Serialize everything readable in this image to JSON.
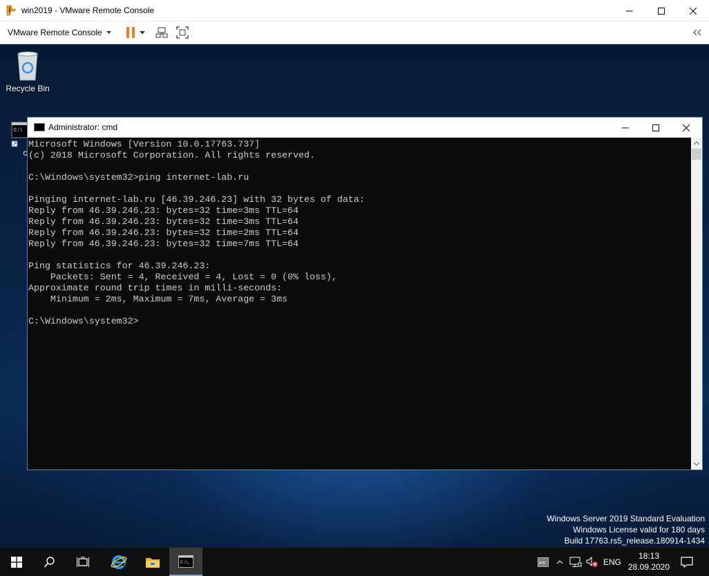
{
  "vmware": {
    "title": "win2019 - VMware Remote Console",
    "menu_label": "VMware Remote Console"
  },
  "desktop": {
    "icons": [
      {
        "label": "Recycle Bin"
      },
      {
        "label": "cmd"
      }
    ],
    "watermark": {
      "line1": "Windows Server 2019 Standard Evaluation",
      "line2": "Windows License valid for 180 days",
      "line3": "Build 17763.rs5_release.180914-1434"
    }
  },
  "cmd": {
    "title": "Administrator: cmd",
    "lines": [
      "Microsoft Windows [Version 10.0.17763.737]",
      "(c) 2018 Microsoft Corporation. All rights reserved.",
      "",
      "C:\\Windows\\system32>ping internet-lab.ru",
      "",
      "Pinging internet-lab.ru [46.39.246.23] with 32 bytes of data:",
      "Reply from 46.39.246.23: bytes=32 time=3ms TTL=64",
      "Reply from 46.39.246.23: bytes=32 time=3ms TTL=64",
      "Reply from 46.39.246.23: bytes=32 time=2ms TTL=64",
      "Reply from 46.39.246.23: bytes=32 time=7ms TTL=64",
      "",
      "Ping statistics for 46.39.246.23:",
      "    Packets: Sent = 4, Received = 4, Lost = 0 (0% loss),",
      "Approximate round trip times in milli-seconds:",
      "    Minimum = 2ms, Maximum = 7ms, Average = 3ms",
      "",
      "C:\\Windows\\system32>"
    ]
  },
  "taskbar": {
    "language": "ENG",
    "time": "18:13",
    "date": "28.09.2020"
  },
  "colors": {
    "console_bg": "#0c0c0c",
    "console_text": "#cccccc",
    "pause_orange": "#f07d1a",
    "taskbar_bg": "#101010"
  }
}
